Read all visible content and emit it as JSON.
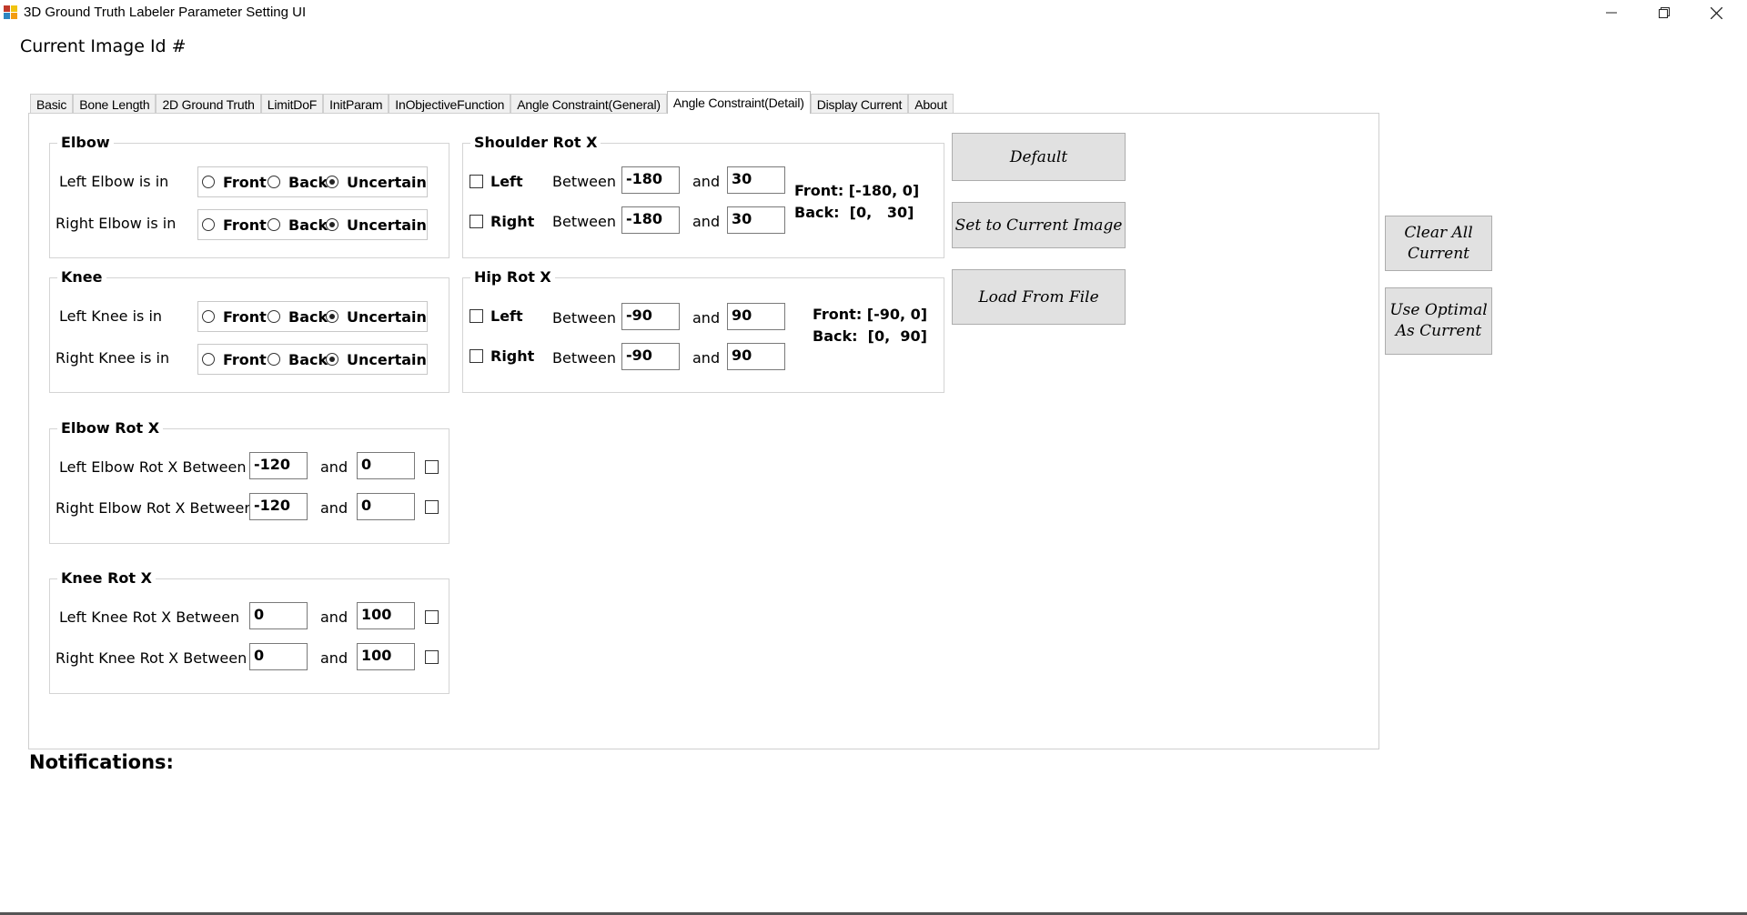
{
  "window": {
    "title": "3D Ground Truth Labeler Parameter Setting UI",
    "icons": [
      "app-icon",
      "minimize-icon",
      "restore-icon",
      "close-icon"
    ]
  },
  "header": {
    "image_id_label": "Current Image Id #"
  },
  "tabs": [
    {
      "label": "Basic"
    },
    {
      "label": "Bone Length"
    },
    {
      "label": "2D Ground Truth"
    },
    {
      "label": "LimitDoF"
    },
    {
      "label": "InitParam"
    },
    {
      "label": "InObjectiveFunction"
    },
    {
      "label": "Angle Constraint(General)"
    },
    {
      "label": "Angle Constraint(Detail)",
      "active": true
    },
    {
      "label": "Display Current"
    },
    {
      "label": "About"
    }
  ],
  "elbow": {
    "title": "Elbow",
    "left_label": "Left Elbow is in",
    "right_label": "Right Elbow is in",
    "left_selected": "Uncertain",
    "right_selected": "Uncertain"
  },
  "knee": {
    "title": "Knee",
    "left_label": "Left Knee is in",
    "right_label": "Right Knee is in",
    "left_selected": "Uncertain",
    "right_selected": "Uncertain"
  },
  "options": {
    "front": "Front",
    "back": "Back",
    "uncertain": "Uncertain"
  },
  "shoulder_rot_x": {
    "title": "Shoulder Rot X",
    "left_label": "Left",
    "right_label": "Right",
    "between": "Between",
    "and": "and",
    "left_min": "-180",
    "left_max": "30",
    "right_min": "-180",
    "right_max": "30",
    "left_checked": false,
    "right_checked": false,
    "front_hint": "Front: [-180, 0]",
    "back_hint": "Back:  [0,   30]"
  },
  "hip_rot_x": {
    "title": "Hip Rot X",
    "left_label": "Left",
    "right_label": "Right",
    "between": "Between",
    "and": "and",
    "left_min": "-90",
    "left_max": "90",
    "right_min": "-90",
    "right_max": "90",
    "left_checked": false,
    "right_checked": false,
    "front_hint": "Front: [-90, 0]",
    "back_hint": "Back:  [0,  90]"
  },
  "elbow_rot_x": {
    "title": "Elbow Rot X",
    "left_label": "Left Elbow Rot X Between",
    "right_label": "Right Elbow Rot X Between",
    "and": "and",
    "left_min": "-120",
    "left_max": "0",
    "right_min": "-120",
    "right_max": "0"
  },
  "knee_rot_x": {
    "title": "Knee Rot X",
    "left_label": "Left Knee Rot X Between",
    "right_label": "Right Knee Rot X Between",
    "and": "and",
    "left_min": "0",
    "left_max": "100",
    "right_min": "0",
    "right_max": "100"
  },
  "buttons": {
    "default": "Default",
    "set_current": "Set to Current Image",
    "load_file": "Load From File",
    "clear_all_line1": "Clear All",
    "clear_all_line2": "Current",
    "use_optimal_line1": "Use Optimal",
    "use_optimal_line2": "As Current"
  },
  "notifications": {
    "label": "Notifications:"
  },
  "colors": {
    "button_bg": "#e1e1e1",
    "border": "#d4d4d4",
    "tab_bg": "#f0f0f0"
  }
}
